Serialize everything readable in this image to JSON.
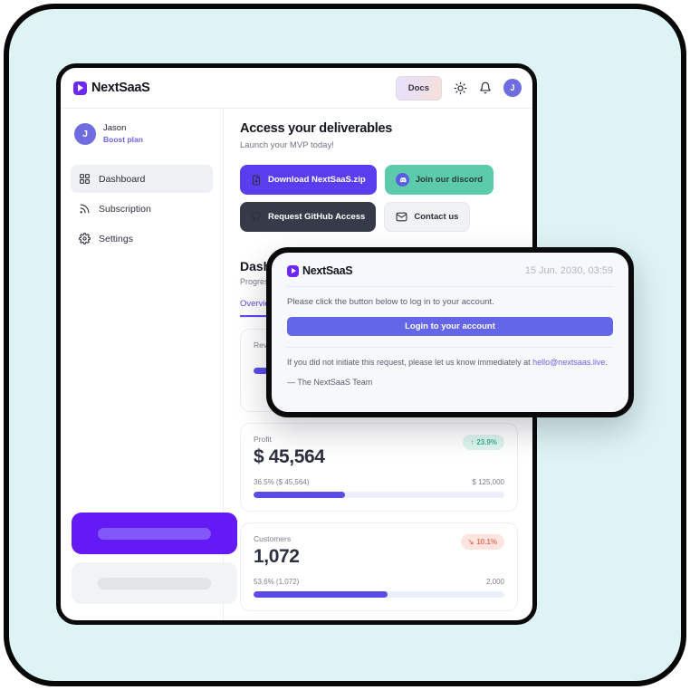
{
  "app": {
    "brand": "NextSaaS",
    "topbar": {
      "docs_label": "Docs",
      "theme_icon": "sun-icon",
      "bell_icon": "bell-icon",
      "avatar_initial": "J"
    }
  },
  "sidebar": {
    "user": {
      "initial": "J",
      "name": "Jason",
      "plan": "Boost plan"
    },
    "items": [
      {
        "label": "Dashboard",
        "icon": "grid-icon",
        "active": true
      },
      {
        "label": "Subscription",
        "icon": "rss-icon",
        "active": false
      },
      {
        "label": "Settings",
        "icon": "gear-icon",
        "active": false
      }
    ]
  },
  "main": {
    "title": "Access your deliverables",
    "subtitle": "Launch your MVP today!",
    "actions": [
      {
        "label": "Download NextSaaS.zip",
        "icon": "file-download-icon",
        "style": "purple"
      },
      {
        "label": "Join our discord",
        "icon": "discord-icon",
        "style": "teal"
      },
      {
        "label": "Request GitHub Access",
        "icon": "github-icon",
        "style": "dark"
      },
      {
        "label": "Contact us",
        "icon": "envelope-icon",
        "style": "light"
      }
    ],
    "section": {
      "title": "Dashboard",
      "subtitle": "Progress overview",
      "tabs": [
        {
          "label": "Overview",
          "active": true
        }
      ]
    },
    "stats": [
      {
        "label": "Revenue",
        "value": "",
        "badge": "",
        "badge_dir": "up",
        "foot_left": "",
        "foot_right": "",
        "progress_pct": 17
      },
      {
        "label": "Profit",
        "value": "$ 45,564",
        "badge": "23.9%",
        "badge_dir": "up",
        "badge_arrow": "↑",
        "foot_left": "36.5% ($ 45,564)",
        "foot_right": "$ 125,000",
        "progress_pct": 36.5
      },
      {
        "label": "Customers",
        "value": "1,072",
        "badge": "10.1%",
        "badge_dir": "down",
        "badge_arrow": "↘",
        "foot_left": "53.6% (1,072)",
        "foot_right": "2,000",
        "progress_pct": 53.6
      }
    ]
  },
  "email_modal": {
    "brand": "NextSaaS",
    "date": "15 Jun. 2030, 03:59",
    "body_text": "Please click the button below to log in to your account.",
    "button_label": "Login to your account",
    "note_prefix": "If you did not initiate this request, please let us know immediately at ",
    "note_email": "hello@nextsaas.live",
    "note_suffix": ".",
    "signature": "— The NextSaaS Team"
  },
  "colors": {
    "page_background": "#ddf3f4",
    "frame_border": "#080808",
    "brand_purple": "#6d28f5",
    "cta_purple": "#5b3df0",
    "cta_teal": "#5ccbab",
    "cta_dark": "#373b49",
    "login_button": "#6366e8",
    "badge_up": "#34b693",
    "badge_down": "#e8705e",
    "skeleton_primary": "#6519f5",
    "skeleton_muted": "#f2f3f5"
  }
}
